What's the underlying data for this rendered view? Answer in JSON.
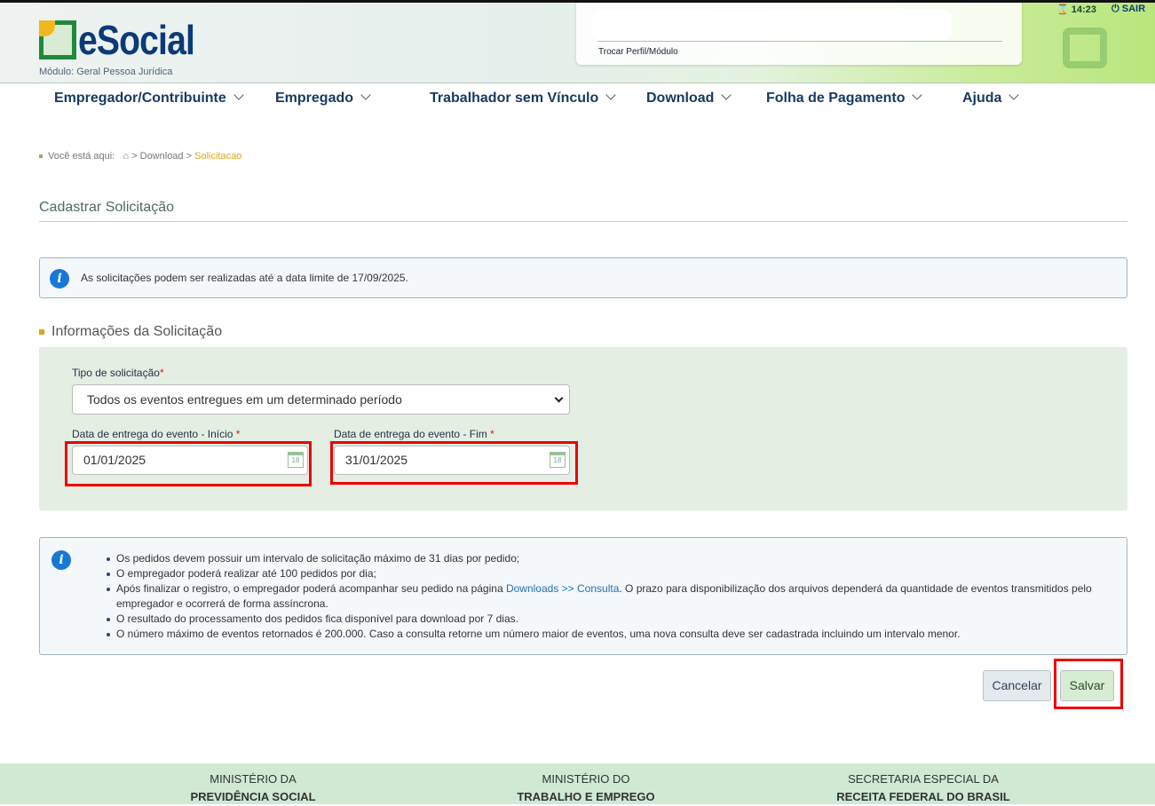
{
  "header": {
    "logo": "eSocial",
    "module": "Módulo: Geral Pessoa Jurídica",
    "switch_profile": "Trocar Perfil/Módulo",
    "timer": "14:23",
    "logout": "SAIR"
  },
  "nav": [
    "Empregador/Contribuinte",
    "Empregado",
    "Trabalhador sem Vínculo",
    "Download",
    "Folha de Pagamento",
    "Ajuda"
  ],
  "breadcrumb": {
    "label": "Você está aqui:",
    "sep": ">",
    "items": [
      "Download",
      "Solicitacao"
    ]
  },
  "page_title": "Cadastrar Solicitação",
  "alert_limit": "As solicitações podem ser realizadas até a data limite de 17/09/2025.",
  "section_title": "Informações da Solicitação",
  "form": {
    "type_label": "Tipo de solicitação",
    "type_value": "Todos os eventos entregues em um determinado período",
    "start_label": "Data de entrega do evento - Início",
    "start_value": "01/01/2025",
    "end_label": "Data de entrega do evento - Fim",
    "end_value": "31/01/2025",
    "required": "*",
    "cal_day": "18"
  },
  "notes": {
    "n1": "Os pedidos devem possuir um intervalo de solicitação máximo de 31 dias por pedido;",
    "n2": "O empregador poderá realizar até 100 pedidos por dia;",
    "n3a": "Após finalizar o registro, o empregador poderá acompanhar seu pedido na página ",
    "n3link": "Downloads >> Consulta",
    "n3b": ". O prazo para disponibilização dos arquivos dependerá da quantidade de eventos transmitidos pelo empregador e ocorrerá de forma assíncrona.",
    "n4": "O resultado do processamento dos pedidos fica disponível para download por 7 dias.",
    "n5": "O número máximo de eventos retornados é 200.000. Caso a consulta retorne um número maior de eventos, uma nova consulta deve ser cadastrada incluindo um intervalo menor."
  },
  "buttons": {
    "cancel": "Cancelar",
    "save": "Salvar"
  },
  "footer": [
    {
      "l1": "MINISTÉRIO DA",
      "l2": "PREVIDÊNCIA SOCIAL"
    },
    {
      "l1": "MINISTÉRIO DO",
      "l2": "TRABALHO E EMPREGO"
    },
    {
      "l1": "SECRETARIA ESPECIAL DA",
      "l2": "RECEITA FEDERAL DO BRASIL"
    }
  ]
}
